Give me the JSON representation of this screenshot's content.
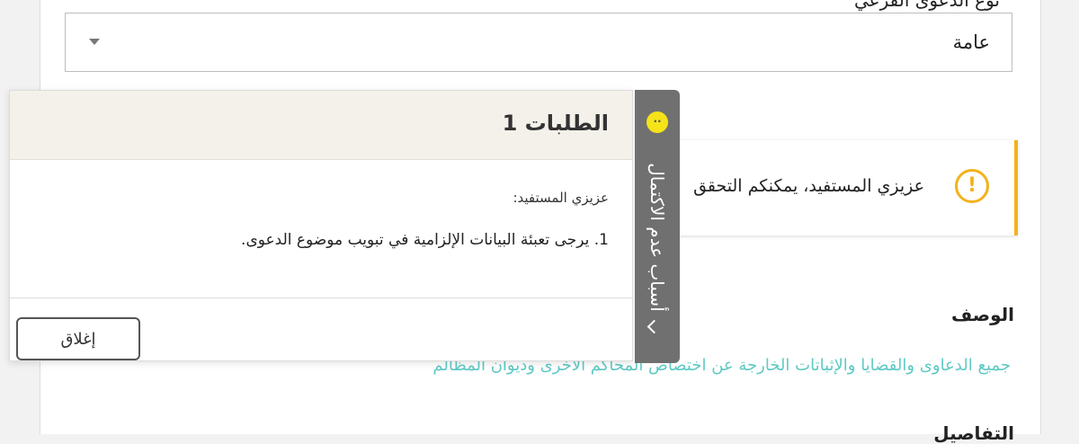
{
  "form": {
    "top_label_fragment": "نوع الدعوى الفرعي",
    "select_value": "عامة",
    "alert_text": "عزيزي المستفيد، يمكنكم التحقق",
    "description_label": "الوصف",
    "description_text": "جميع الدعاوى والقضايا والإثباتات الخارجة عن اختصاص المحاكم الأخرى وديوان المظالم",
    "bottom_label_fragment": "التفاصيل"
  },
  "panel": {
    "title": "الطلبات 1",
    "greeting": "عزيزي المستفيد:",
    "message": "1. يرجى تعبئة البيانات الإلزامية في تبويب موضوع الدعوى.",
    "close_label": "إغلاق"
  },
  "tab": {
    "label": "أسباب عدم الاكتمال",
    "dot_glyph": "··"
  },
  "colors": {
    "accent": "#f3b21b",
    "link": "#5fc9c4",
    "tab_bg": "#707070",
    "panel_header_bg": "#f4f1ea"
  },
  "icons": [
    "chevron-down-icon",
    "warning-icon",
    "chevron-icon",
    "status-dot-icon"
  ]
}
